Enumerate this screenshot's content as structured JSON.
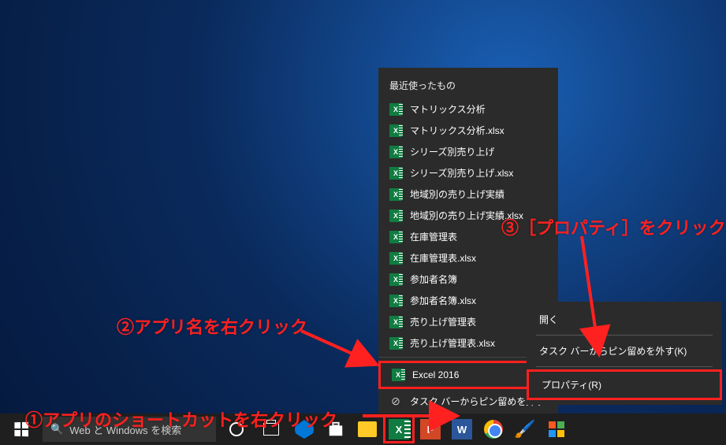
{
  "jumplist": {
    "header": "最近使ったもの",
    "items": [
      "マトリックス分析",
      "マトリックス分析.xlsx",
      "シリーズ別売り上げ",
      "シリーズ別売り上げ.xlsx",
      "地域別の売り上げ実績",
      "地域別の売り上げ実績.xlsx",
      "在庫管理表",
      "在庫管理表.xlsx",
      "参加者名簿",
      "参加者名簿.xlsx",
      "売り上げ管理表",
      "売り上げ管理表.xlsx"
    ],
    "app_label": "Excel 2016",
    "unpin_label": "タスク バーからピン留めを外す"
  },
  "submenu": {
    "open": "開く",
    "unpin_k": "タスク バーからピン留めを外す(K)",
    "properties": "プロパティ(R)"
  },
  "taskbar": {
    "search_placeholder": "Web と Windows を検索"
  },
  "callouts": {
    "c1": "①アプリのショートカットを右クリック",
    "c2": "②アプリ名を右クリック",
    "c3": "③［プロパティ］をクリック"
  }
}
